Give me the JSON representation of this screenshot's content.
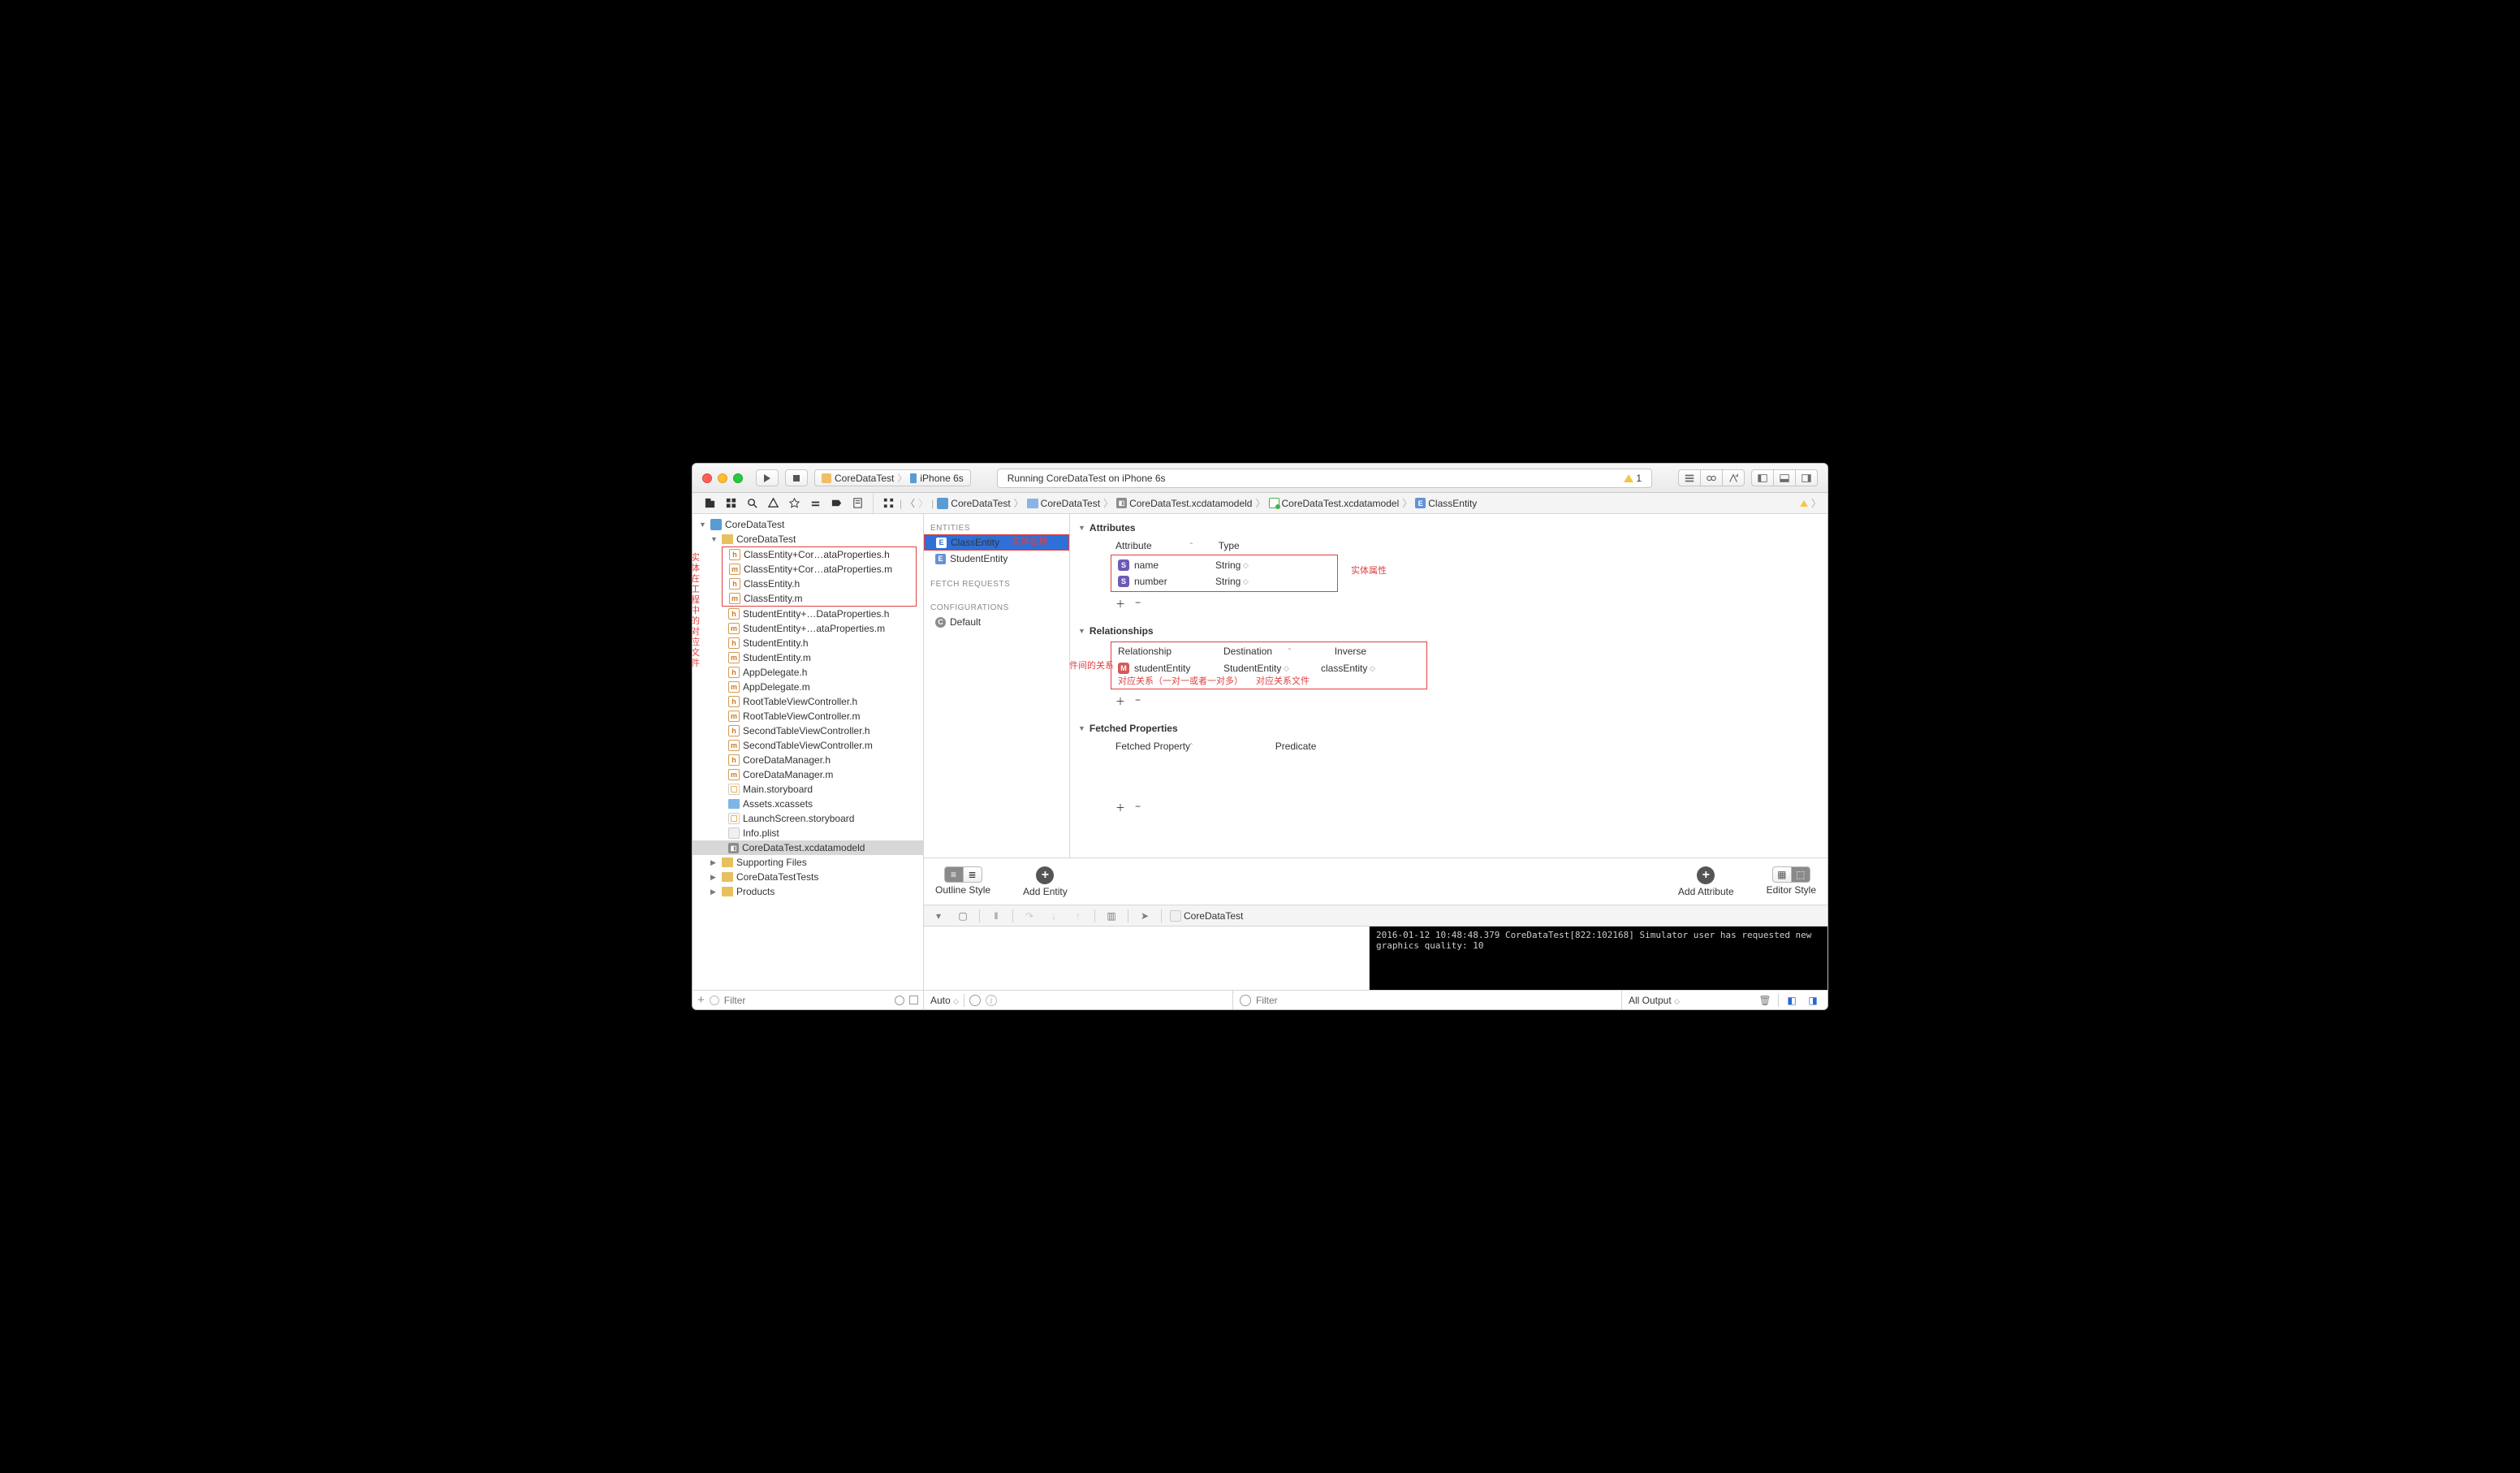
{
  "toolbar": {
    "scheme_app": "CoreDataTest",
    "scheme_device": "iPhone 6s",
    "status": "Running CoreDataTest on iPhone 6s",
    "warning_count": "1"
  },
  "sidebar_note": "实体\n在工\n程中\n的对\n应文\n件",
  "project_tree": {
    "root": "CoreDataTest",
    "group": "CoreDataTest",
    "files_boxed": [
      "ClassEntity+Cor…ataProperties.h",
      "ClassEntity+Cor…ataProperties.m",
      "ClassEntity.h",
      "ClassEntity.m"
    ],
    "files_rest": [
      "StudentEntity+…DataProperties.h",
      "StudentEntity+…ataProperties.m",
      "StudentEntity.h",
      "StudentEntity.m",
      "AppDelegate.h",
      "AppDelegate.m",
      "RootTableViewController.h",
      "RootTableViewController.m",
      "SecondTableViewController.h",
      "SecondTableViewController.m",
      "CoreDataManager.h",
      "CoreDataManager.m",
      "Main.storyboard",
      "Assets.xcassets",
      "LaunchScreen.storyboard",
      "Info.plist",
      "CoreDataTest.xcdatamodeld"
    ],
    "groups_below": [
      "Supporting Files",
      "CoreDataTestTests",
      "Products"
    ]
  },
  "jumpbar": [
    "CoreDataTest",
    "CoreDataTest",
    "CoreDataTest.xcdatamodeld",
    "CoreDataTest.xcdatamodel",
    "ClassEntity"
  ],
  "entities_panel": {
    "sec_entities": "ENTITIES",
    "entities": [
      "ClassEntity",
      "StudentEntity"
    ],
    "sec_fetch": "FETCH REQUESTS",
    "sec_config": "CONFIGURATIONS",
    "config_default": "Default",
    "note_entity_name": "实体名称"
  },
  "editor": {
    "sec_attributes": "Attributes",
    "attr_head_attr": "Attribute",
    "attr_head_type": "Type",
    "attrs": [
      {
        "name": "name",
        "type": "String"
      },
      {
        "name": "number",
        "type": "String"
      }
    ],
    "note_attr": "实体属性",
    "sec_rel": "Relationships",
    "rel_head_rel": "Relationship",
    "rel_head_dest": "Destination",
    "rel_head_inv": "Inverse",
    "rel": {
      "name": "studentEntity",
      "dest": "StudentEntity",
      "inv": "classEntity"
    },
    "note_rel_left": "实体文件间的关系",
    "note_rel_under1": "对应关系（一对一或者一对多）",
    "note_rel_under2": "对应关系文件",
    "sec_fetched": "Fetched Properties",
    "fp_head1": "Fetched Property",
    "fp_head2": "Predicate"
  },
  "model_bottom": {
    "outline": "Outline Style",
    "add_entity": "Add Entity",
    "add_attr": "Add Attribute",
    "editor": "Editor Style"
  },
  "debug": {
    "target": "CoreDataTest",
    "console": "2016-01-12 10:48:48.379 CoreDataTest[822:102168] Simulator user has requested new graphics quality: 10",
    "auto": "Auto",
    "filter": "Filter",
    "all_output": "All Output"
  },
  "nav_filter_placeholder": "Filter"
}
